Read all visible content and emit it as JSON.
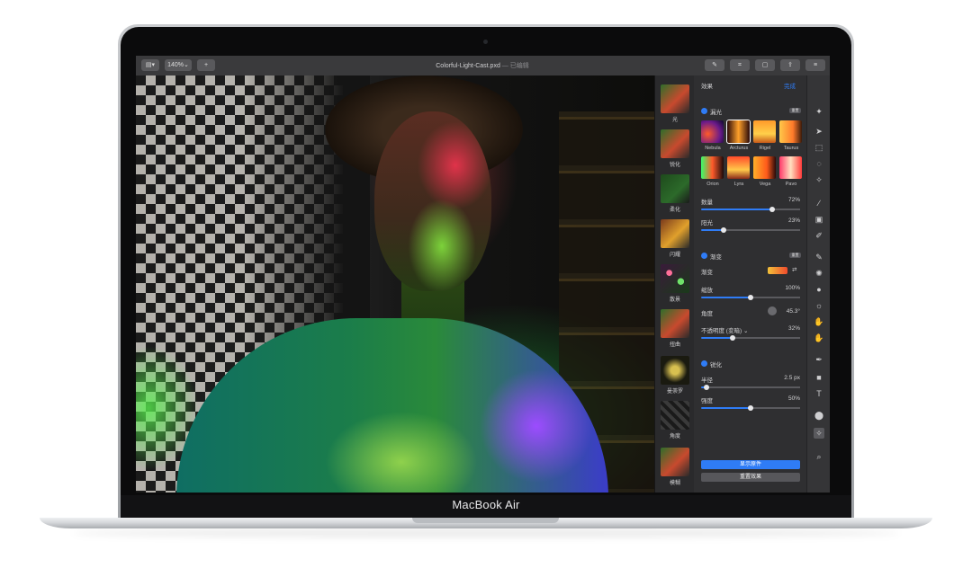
{
  "device_label": "MacBook Air",
  "toolbar": {
    "sidebar_toggle": "▤▾",
    "zoom": "140%",
    "add": "+",
    "doc_name": "Colorful-Light-Cast.pxd",
    "doc_status": "— 已编辑",
    "right_icons": [
      "brush-icon",
      "crop-icon",
      "document-icon",
      "share-icon",
      "sliders-icon"
    ]
  },
  "thumbs": [
    {
      "label": "光"
    },
    {
      "label": "锐化"
    },
    {
      "label": "柔化"
    },
    {
      "label": "闪耀"
    },
    {
      "label": "散景"
    },
    {
      "label": "扭曲"
    },
    {
      "label": "曼荼罗"
    },
    {
      "label": "角度"
    },
    {
      "label": "模糊"
    }
  ],
  "panel": {
    "header_label": "效果",
    "header_action": "完成",
    "leak": {
      "title": "漏光",
      "badge": "重置",
      "presets": [
        "Nebula",
        "Arcturus",
        "Rigel",
        "Taurus",
        "Orion",
        "Lyra",
        "Vega",
        "Pavo"
      ],
      "amount_label": "数量",
      "amount_value": "72%",
      "amount": 0.72,
      "shadow_label": "阳光",
      "shadow_value": "23%",
      "shadow": 0.23
    },
    "gradient": {
      "title": "渐变",
      "badge": "重置",
      "gradient_label": "渐变",
      "scale_label": "缩放",
      "scale_value": "100%",
      "scale": 0.5,
      "angle_label": "角度",
      "angle_value": "45.3°",
      "opacity_label": "不透明度 (变暗) ⌄",
      "opacity_value": "32%",
      "opacity": 0.32
    },
    "sharpen": {
      "title": "锐化",
      "radius_label": "半径",
      "radius_value": "2.5 px",
      "radius": 0.05,
      "intensity_label": "强度",
      "intensity_value": "50%",
      "intensity": 0.5
    },
    "primary_button": "显示原件",
    "secondary_button": "重置效果"
  },
  "tools": [
    "arrange-icon",
    "select-icon",
    "lasso-icon",
    "magic-wand-icon",
    "paint-brush-icon",
    "bucket-icon",
    "eraser-icon",
    "clone-icon",
    "repair-icon",
    "blur-icon",
    "sharpen-icon",
    "smudge-icon",
    "pen-icon",
    "shape-icon",
    "type-icon",
    "color-icon",
    "effects-icon",
    "zoom-icon"
  ],
  "colors": {
    "accent": "#2f7cf6",
    "panel": "#2f2f31",
    "toolbar": "#3a3a3c"
  }
}
